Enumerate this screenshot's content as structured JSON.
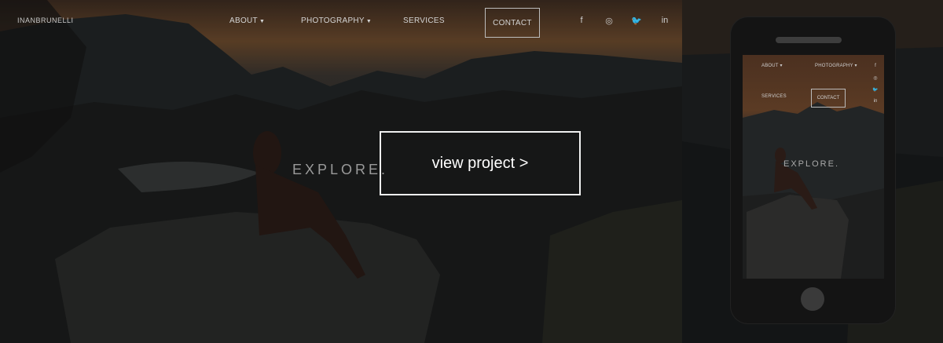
{
  "site": {
    "logo": "INANBRUNELLI"
  },
  "nav": {
    "about": "ABOUT",
    "photography": "PHOTOGRAPHY",
    "services": "SERVICES",
    "contact": "CONTACT"
  },
  "social": [
    {
      "icon": "facebook-icon",
      "glyph": "f"
    },
    {
      "icon": "instagram-icon",
      "glyph": "◎"
    },
    {
      "icon": "twitter-icon",
      "glyph": "🐦"
    },
    {
      "icon": "linkedin-icon",
      "glyph": "in"
    }
  ],
  "hero": {
    "explore": "EXPLORE."
  },
  "cta": {
    "label": "view project >"
  },
  "mobile": {
    "about": "ABOUT",
    "photography": "PHOTOGRAPHY",
    "services": "SERVICES",
    "contact": "CONTACT",
    "explore": "EXPLORE."
  }
}
